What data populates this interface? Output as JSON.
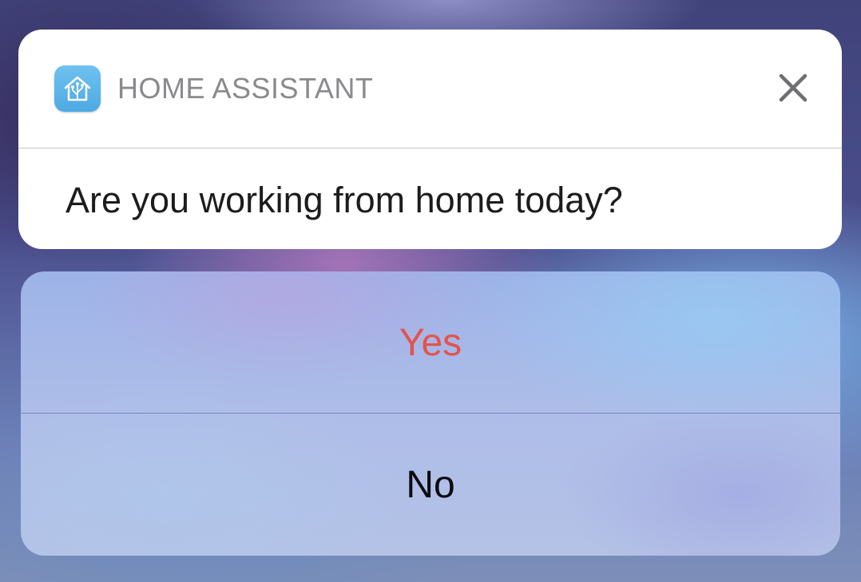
{
  "notification": {
    "app_name": "HOME ASSISTANT",
    "app_icon": "home-assistant-icon",
    "close_icon": "close-icon",
    "message": "Are you working from home today?"
  },
  "actions": [
    {
      "label": "Yes",
      "color": "#e5534b"
    },
    {
      "label": "No",
      "color": "#0c0c10"
    }
  ],
  "colors": {
    "app_icon_bg": "#5bb6ea",
    "card_bg": "#ffffff",
    "app_name_text": "#8a8a8e"
  }
}
